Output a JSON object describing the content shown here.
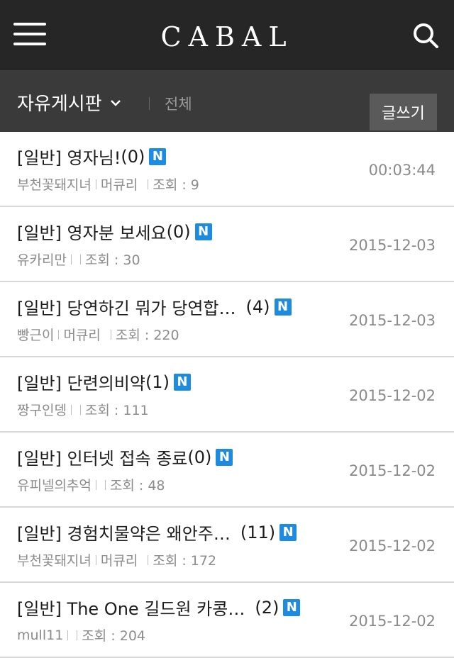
{
  "header": {
    "logo": "CABAL",
    "menu_icon": "hamburger-menu-icon",
    "search_icon": "search-icon"
  },
  "subheader": {
    "board": "자유게시판",
    "filter": "전체",
    "write_button": "글쓰기"
  },
  "posts": [
    {
      "category": "[일반]",
      "title": "영자님!",
      "comments": "(0)",
      "badge": "N",
      "author": "부천꽃돼지녀",
      "server": "머큐리",
      "views_label": "조회 : 9",
      "date": "00:03:44"
    },
    {
      "category": "[일반]",
      "title": "영자분 보세요",
      "comments": "(0)",
      "badge": "N",
      "author": "유카리만",
      "server": "",
      "views_label": "조회 : 30",
      "date": "2015-12-03"
    },
    {
      "category": "[일반]",
      "title": "당연하긴 뭐가 당연합…",
      "comments": "(4)",
      "badge": "N",
      "author": "빵근이",
      "server": "머큐리",
      "views_label": "조회 : 220",
      "date": "2015-12-03"
    },
    {
      "category": "[일반]",
      "title": "단련의비약",
      "comments": "(1)",
      "badge": "N",
      "author": "짱구인뎅",
      "server": "",
      "views_label": "조회 : 111",
      "date": "2015-12-02"
    },
    {
      "category": "[일반]",
      "title": "인터넷 접속 종료",
      "comments": "(0)",
      "badge": "N",
      "author": "유피넬의추억",
      "server": "",
      "views_label": "조회 : 48",
      "date": "2015-12-02"
    },
    {
      "category": "[일반]",
      "title": "경험치물약은 왜안주…",
      "comments": "(11)",
      "badge": "N",
      "author": "부천꽃돼지녀",
      "server": "머큐리",
      "views_label": "조회 : 172",
      "date": "2015-12-02"
    },
    {
      "category": "[일반]",
      "title": "The One 길드원 카콩…",
      "comments": "(2)",
      "badge": "N",
      "author": "mull11",
      "server": "",
      "views_label": "조회 : 204",
      "date": "2015-12-02"
    }
  ]
}
